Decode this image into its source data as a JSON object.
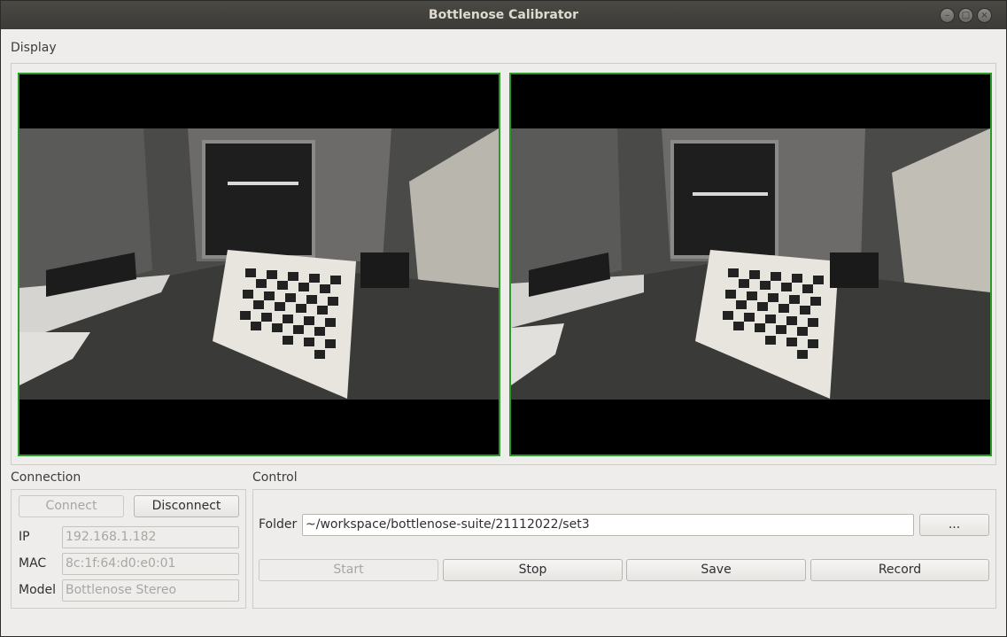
{
  "window": {
    "title": "Bottlenose Calibrator",
    "controls": {
      "minimize": "–",
      "maximize": "□",
      "close": "×"
    }
  },
  "display": {
    "label": "Display",
    "cameras": [
      {
        "name": "left-camera-feed"
      },
      {
        "name": "right-camera-feed"
      }
    ],
    "border_color": "#2a9a2a"
  },
  "connection": {
    "label": "Connection",
    "connect_label": "Connect",
    "disconnect_label": "Disconnect",
    "ip_label": "IP",
    "ip_value": "192.168.1.182",
    "mac_label": "MAC",
    "mac_value": "8c:1f:64:d0:e0:01",
    "model_label": "Model",
    "model_value": "Bottlenose Stereo"
  },
  "control": {
    "label": "Control",
    "folder_label": "Folder",
    "folder_value": "~/workspace/bottlenose-suite/21112022/set3",
    "browse_label": "...",
    "start_label": "Start",
    "stop_label": "Stop",
    "save_label": "Save",
    "record_label": "Record"
  }
}
